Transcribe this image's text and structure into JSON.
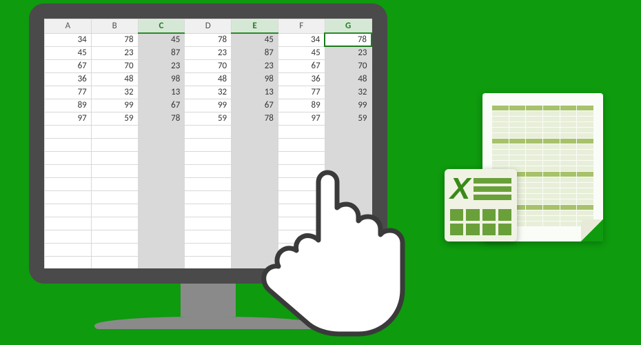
{
  "spreadsheet": {
    "columns": [
      "A",
      "B",
      "C",
      "D",
      "E",
      "F",
      "G"
    ],
    "selectedColumns": [
      "C",
      "E",
      "G"
    ],
    "activeCell": {
      "col": "G",
      "row": 0
    },
    "rows": [
      [
        34,
        78,
        45,
        78,
        45,
        34,
        78
      ],
      [
        45,
        23,
        87,
        23,
        87,
        45,
        23
      ],
      [
        67,
        70,
        23,
        70,
        23,
        67,
        70
      ],
      [
        36,
        48,
        98,
        48,
        98,
        36,
        48
      ],
      [
        77,
        32,
        13,
        32,
        13,
        77,
        32
      ],
      [
        89,
        99,
        67,
        99,
        67,
        89,
        99
      ],
      [
        97,
        59,
        78,
        59,
        78,
        97,
        59
      ]
    ],
    "totalVisibleRows": 18
  },
  "chart_data": {
    "type": "table",
    "title": "",
    "columns": [
      "A",
      "B",
      "C",
      "D",
      "E",
      "F",
      "G"
    ],
    "rows": [
      [
        34,
        78,
        45,
        78,
        45,
        34,
        78
      ],
      [
        45,
        23,
        87,
        23,
        87,
        45,
        23
      ],
      [
        67,
        70,
        23,
        70,
        23,
        67,
        70
      ],
      [
        36,
        48,
        98,
        48,
        98,
        36,
        48
      ],
      [
        77,
        32,
        13,
        32,
        13,
        77,
        32
      ],
      [
        89,
        99,
        67,
        99,
        67,
        89,
        99
      ],
      [
        97,
        59,
        78,
        59,
        78,
        97,
        59
      ]
    ]
  },
  "icons": {
    "excel": "excel-app-icon",
    "hand": "pointing-hand-cursor"
  }
}
